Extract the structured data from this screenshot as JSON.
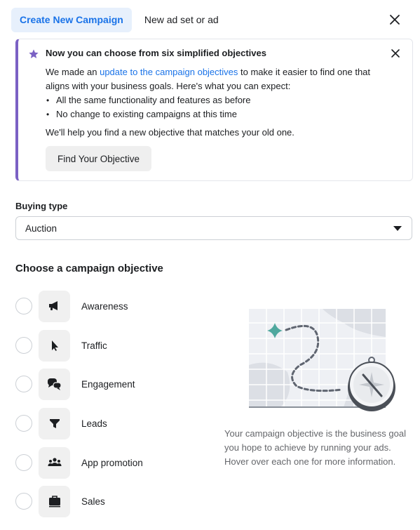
{
  "tabs": {
    "active": "Create New Campaign",
    "secondary": "New ad set or ad"
  },
  "banner": {
    "title": "Now you can choose from six simplified objectives",
    "body_prefix": "We made an ",
    "body_link": "update to the campaign objectives",
    "body_suffix": " to make it easier to find one that aligns with your business goals. Here's what you can expect:",
    "bullets": [
      "All the same functionality and features as before",
      "No change to existing campaigns at this time"
    ],
    "footer": "We'll help you find a new objective that matches your old one.",
    "button_label": "Find Your Objective",
    "accent_color": "#7b61c4"
  },
  "buying_type": {
    "label": "Buying type",
    "selected": "Auction"
  },
  "objectives": {
    "title": "Choose a campaign objective",
    "items": [
      {
        "label": "Awareness",
        "icon": "megaphone-icon",
        "selected": false
      },
      {
        "label": "Traffic",
        "icon": "cursor-icon",
        "selected": false
      },
      {
        "label": "Engagement",
        "icon": "chat-bubbles-icon",
        "selected": false
      },
      {
        "label": "Leads",
        "icon": "funnel-icon",
        "selected": false
      },
      {
        "label": "App promotion",
        "icon": "people-group-icon",
        "selected": false
      },
      {
        "label": "Sales",
        "icon": "briefcase-icon",
        "selected": false
      }
    ],
    "description": "Your campaign objective is the business goal you hope to achieve by running your ads. Hover over each one for more information."
  }
}
